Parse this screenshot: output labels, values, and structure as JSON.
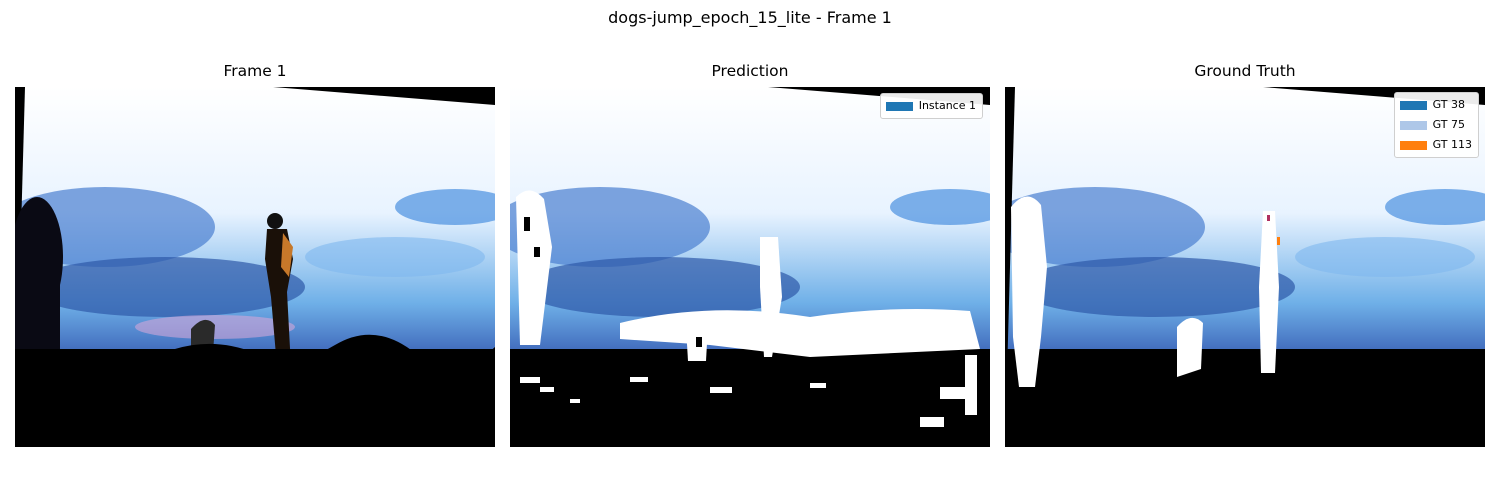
{
  "figure": {
    "title": "dogs-jump_epoch_15_lite - Frame 1"
  },
  "panels": [
    {
      "title": "Frame 1"
    },
    {
      "title": "Prediction"
    },
    {
      "title": "Ground Truth"
    }
  ],
  "prediction_legend": [
    {
      "label": "Instance 1",
      "color": "#1f77b4"
    }
  ],
  "ground_truth_legend": [
    {
      "label": "GT 38",
      "color": "#1f77b4"
    },
    {
      "label": "GT 75",
      "color": "#aec7e8"
    },
    {
      "label": "GT 113",
      "color": "#ff7f0e"
    }
  ]
}
